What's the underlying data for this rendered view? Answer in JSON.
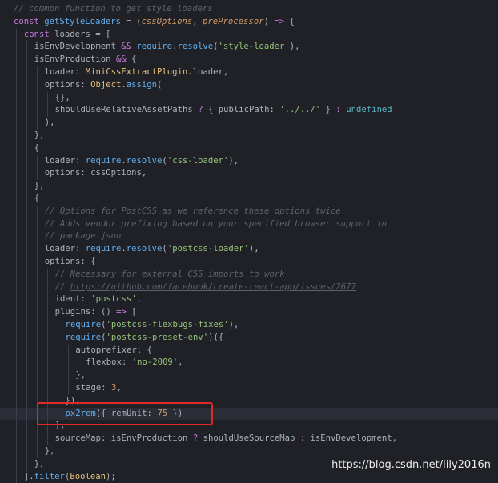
{
  "editor": {
    "lines": [
      {
        "indent": 0,
        "tokens": [
          {
            "t": "// common function to get style loaders",
            "c": "cm"
          }
        ]
      },
      {
        "indent": 0,
        "tokens": [
          {
            "t": "const ",
            "c": "kw"
          },
          {
            "t": "getStyleLoaders",
            "c": "fn"
          },
          {
            "t": " = (",
            "c": "p"
          },
          {
            "t": "cssOptions",
            "c": "prm"
          },
          {
            "t": ", ",
            "c": "p"
          },
          {
            "t": "preProcessor",
            "c": "prm"
          },
          {
            "t": ") ",
            "c": "p"
          },
          {
            "t": "=>",
            "c": "kw"
          },
          {
            "t": " {",
            "c": "p"
          }
        ]
      },
      {
        "indent": 1,
        "tokens": [
          {
            "t": "const ",
            "c": "kw"
          },
          {
            "t": "loaders",
            "c": "p"
          },
          {
            "t": " = [",
            "c": "p"
          }
        ]
      },
      {
        "indent": 2,
        "tokens": [
          {
            "t": "isEnvDevelopment ",
            "c": "p"
          },
          {
            "t": "&&",
            "c": "kw"
          },
          {
            "t": " ",
            "c": "p"
          },
          {
            "t": "require",
            "c": "fn"
          },
          {
            "t": ".",
            "c": "p"
          },
          {
            "t": "resolve",
            "c": "fn"
          },
          {
            "t": "(",
            "c": "p"
          },
          {
            "t": "'style-loader'",
            "c": "str"
          },
          {
            "t": "),",
            "c": "p"
          }
        ]
      },
      {
        "indent": 2,
        "tokens": [
          {
            "t": "isEnvProduction ",
            "c": "p"
          },
          {
            "t": "&&",
            "c": "kw"
          },
          {
            "t": " {",
            "c": "p"
          }
        ]
      },
      {
        "indent": 3,
        "tokens": [
          {
            "t": "loader: ",
            "c": "p"
          },
          {
            "t": "MiniCssExtractPlugin",
            "c": "cls"
          },
          {
            "t": ".loader,",
            "c": "p"
          }
        ]
      },
      {
        "indent": 3,
        "tokens": [
          {
            "t": "options: ",
            "c": "p"
          },
          {
            "t": "Object",
            "c": "cls"
          },
          {
            "t": ".",
            "c": "p"
          },
          {
            "t": "assign",
            "c": "fn"
          },
          {
            "t": "(",
            "c": "p"
          }
        ]
      },
      {
        "indent": 4,
        "tokens": [
          {
            "t": "{},",
            "c": "p"
          }
        ]
      },
      {
        "indent": 4,
        "tokens": [
          {
            "t": "shouldUseRelativeAssetPaths ",
            "c": "p"
          },
          {
            "t": "?",
            "c": "kw"
          },
          {
            "t": " { publicPath: ",
            "c": "p"
          },
          {
            "t": "'../../'",
            "c": "str"
          },
          {
            "t": " } ",
            "c": "p"
          },
          {
            "t": ":",
            "c": "kw"
          },
          {
            "t": " ",
            "c": "p"
          },
          {
            "t": "undefined",
            "c": "und"
          }
        ]
      },
      {
        "indent": 3,
        "tokens": [
          {
            "t": "),",
            "c": "p"
          }
        ]
      },
      {
        "indent": 2,
        "tokens": [
          {
            "t": "},",
            "c": "p"
          }
        ]
      },
      {
        "indent": 2,
        "tokens": [
          {
            "t": "{",
            "c": "p"
          }
        ]
      },
      {
        "indent": 3,
        "tokens": [
          {
            "t": "loader: ",
            "c": "p"
          },
          {
            "t": "require",
            "c": "fn"
          },
          {
            "t": ".",
            "c": "p"
          },
          {
            "t": "resolve",
            "c": "fn"
          },
          {
            "t": "(",
            "c": "p"
          },
          {
            "t": "'css-loader'",
            "c": "str"
          },
          {
            "t": "),",
            "c": "p"
          }
        ]
      },
      {
        "indent": 3,
        "tokens": [
          {
            "t": "options: cssOptions,",
            "c": "p"
          }
        ]
      },
      {
        "indent": 2,
        "tokens": [
          {
            "t": "},",
            "c": "p"
          }
        ]
      },
      {
        "indent": 2,
        "tokens": [
          {
            "t": "{",
            "c": "p"
          }
        ]
      },
      {
        "indent": 3,
        "tokens": [
          {
            "t": "// Options for PostCSS as we reference these options twice",
            "c": "cm"
          }
        ]
      },
      {
        "indent": 3,
        "tokens": [
          {
            "t": "// Adds vendor prefixing based on your specified browser support in",
            "c": "cm"
          }
        ]
      },
      {
        "indent": 3,
        "tokens": [
          {
            "t": "// package.json",
            "c": "cm"
          }
        ]
      },
      {
        "indent": 3,
        "tokens": [
          {
            "t": "loader: ",
            "c": "p"
          },
          {
            "t": "require",
            "c": "fn"
          },
          {
            "t": ".",
            "c": "p"
          },
          {
            "t": "resolve",
            "c": "fn"
          },
          {
            "t": "(",
            "c": "p"
          },
          {
            "t": "'postcss-loader'",
            "c": "str"
          },
          {
            "t": "),",
            "c": "p"
          }
        ]
      },
      {
        "indent": 3,
        "tokens": [
          {
            "t": "options: {",
            "c": "p"
          }
        ]
      },
      {
        "indent": 4,
        "tokens": [
          {
            "t": "// Necessary for external CSS imports to work",
            "c": "cm"
          }
        ]
      },
      {
        "indent": 4,
        "tokens": [
          {
            "t": "// ",
            "c": "cm"
          },
          {
            "t": "https://github.com/facebook/create-react-app/issues/2677",
            "c": "lnk"
          }
        ]
      },
      {
        "indent": 4,
        "tokens": [
          {
            "t": "ident: ",
            "c": "p"
          },
          {
            "t": "'postcss'",
            "c": "str"
          },
          {
            "t": ",",
            "c": "p"
          }
        ]
      },
      {
        "indent": 4,
        "tokens": [
          {
            "t": "plugins",
            "c": "hl"
          },
          {
            "t": ": () ",
            "c": "p"
          },
          {
            "t": "=>",
            "c": "kw"
          },
          {
            "t": " [",
            "c": "p"
          }
        ]
      },
      {
        "indent": 5,
        "tokens": [
          {
            "t": "require",
            "c": "fn"
          },
          {
            "t": "(",
            "c": "p"
          },
          {
            "t": "'postcss-flexbugs-fixes'",
            "c": "str"
          },
          {
            "t": "),",
            "c": "p"
          }
        ]
      },
      {
        "indent": 5,
        "tokens": [
          {
            "t": "require",
            "c": "fn"
          },
          {
            "t": "(",
            "c": "p"
          },
          {
            "t": "'postcss-preset-env'",
            "c": "str"
          },
          {
            "t": ")({",
            "c": "p"
          }
        ]
      },
      {
        "indent": 6,
        "tokens": [
          {
            "t": "autoprefixer: {",
            "c": "p"
          }
        ]
      },
      {
        "indent": 7,
        "tokens": [
          {
            "t": "flexbox: ",
            "c": "p"
          },
          {
            "t": "'no-2009'",
            "c": "str"
          },
          {
            "t": ",",
            "c": "p"
          }
        ]
      },
      {
        "indent": 6,
        "tokens": [
          {
            "t": "},",
            "c": "p"
          }
        ]
      },
      {
        "indent": 6,
        "tokens": [
          {
            "t": "stage: ",
            "c": "p"
          },
          {
            "t": "3",
            "c": "num"
          },
          {
            "t": ",",
            "c": "p"
          }
        ]
      },
      {
        "indent": 5,
        "tokens": [
          {
            "t": "}),",
            "c": "p"
          }
        ]
      },
      {
        "indent": 5,
        "current": true,
        "tokens": [
          {
            "t": "px2rem",
            "c": "fn"
          },
          {
            "t": "({ remUnit: ",
            "c": "p"
          },
          {
            "t": "75",
            "c": "num"
          },
          {
            "t": " })",
            "c": "p"
          }
        ]
      },
      {
        "indent": 4,
        "tokens": [
          {
            "t": "],",
            "c": "p"
          }
        ]
      },
      {
        "indent": 4,
        "tokens": [
          {
            "t": "sourceMap: isEnvProduction ",
            "c": "p"
          },
          {
            "t": "?",
            "c": "kw"
          },
          {
            "t": " shouldUseSourceMap ",
            "c": "p"
          },
          {
            "t": ":",
            "c": "kw"
          },
          {
            "t": " isEnvDevelopment,",
            "c": "p"
          }
        ]
      },
      {
        "indent": 3,
        "tokens": [
          {
            "t": "},",
            "c": "p"
          }
        ]
      },
      {
        "indent": 2,
        "tokens": [
          {
            "t": "},",
            "c": "p"
          }
        ]
      },
      {
        "indent": 1,
        "tokens": [
          {
            "t": "].",
            "c": "p"
          },
          {
            "t": "filter",
            "c": "fn"
          },
          {
            "t": "(",
            "c": "p"
          },
          {
            "t": "Boolean",
            "c": "cls"
          },
          {
            "t": ");",
            "c": "p"
          }
        ]
      }
    ]
  },
  "watermark": "https://blog.csdn.net/lily2016n",
  "colors": {
    "background": "#1f2127",
    "annotation_border": "#e0282c"
  }
}
